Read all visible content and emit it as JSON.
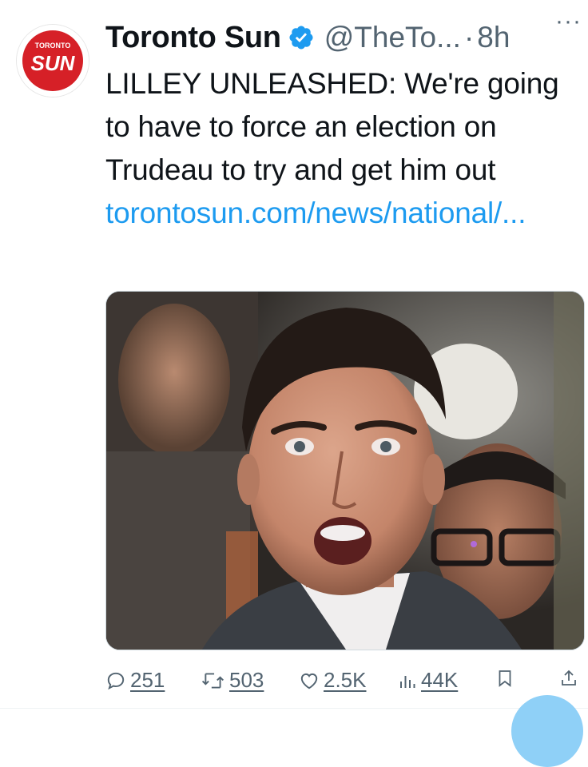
{
  "author": {
    "display_name": "Toronto Sun",
    "handle": "@TheTo...",
    "separator": "·",
    "time": "8h",
    "avatar": {
      "top_text": "TORONTO",
      "main_text": "SUN",
      "color": "#d62027"
    },
    "verified_color": "#1d9bf0"
  },
  "more_label": "···",
  "tweet": {
    "text_before_link": "LILLEY UNLEASHED: We're going to have to force an election on Trudeau to try and get him out ",
    "link_text": "torontosun.com/news/national/..."
  },
  "media": {
    "description_icon": "photo"
  },
  "actions": {
    "replies": "251",
    "retweets": "503",
    "likes": "2.5K",
    "views": "44K"
  },
  "colors": {
    "link": "#1d9bf0",
    "muted": "#536471",
    "text": "#0f1419"
  }
}
